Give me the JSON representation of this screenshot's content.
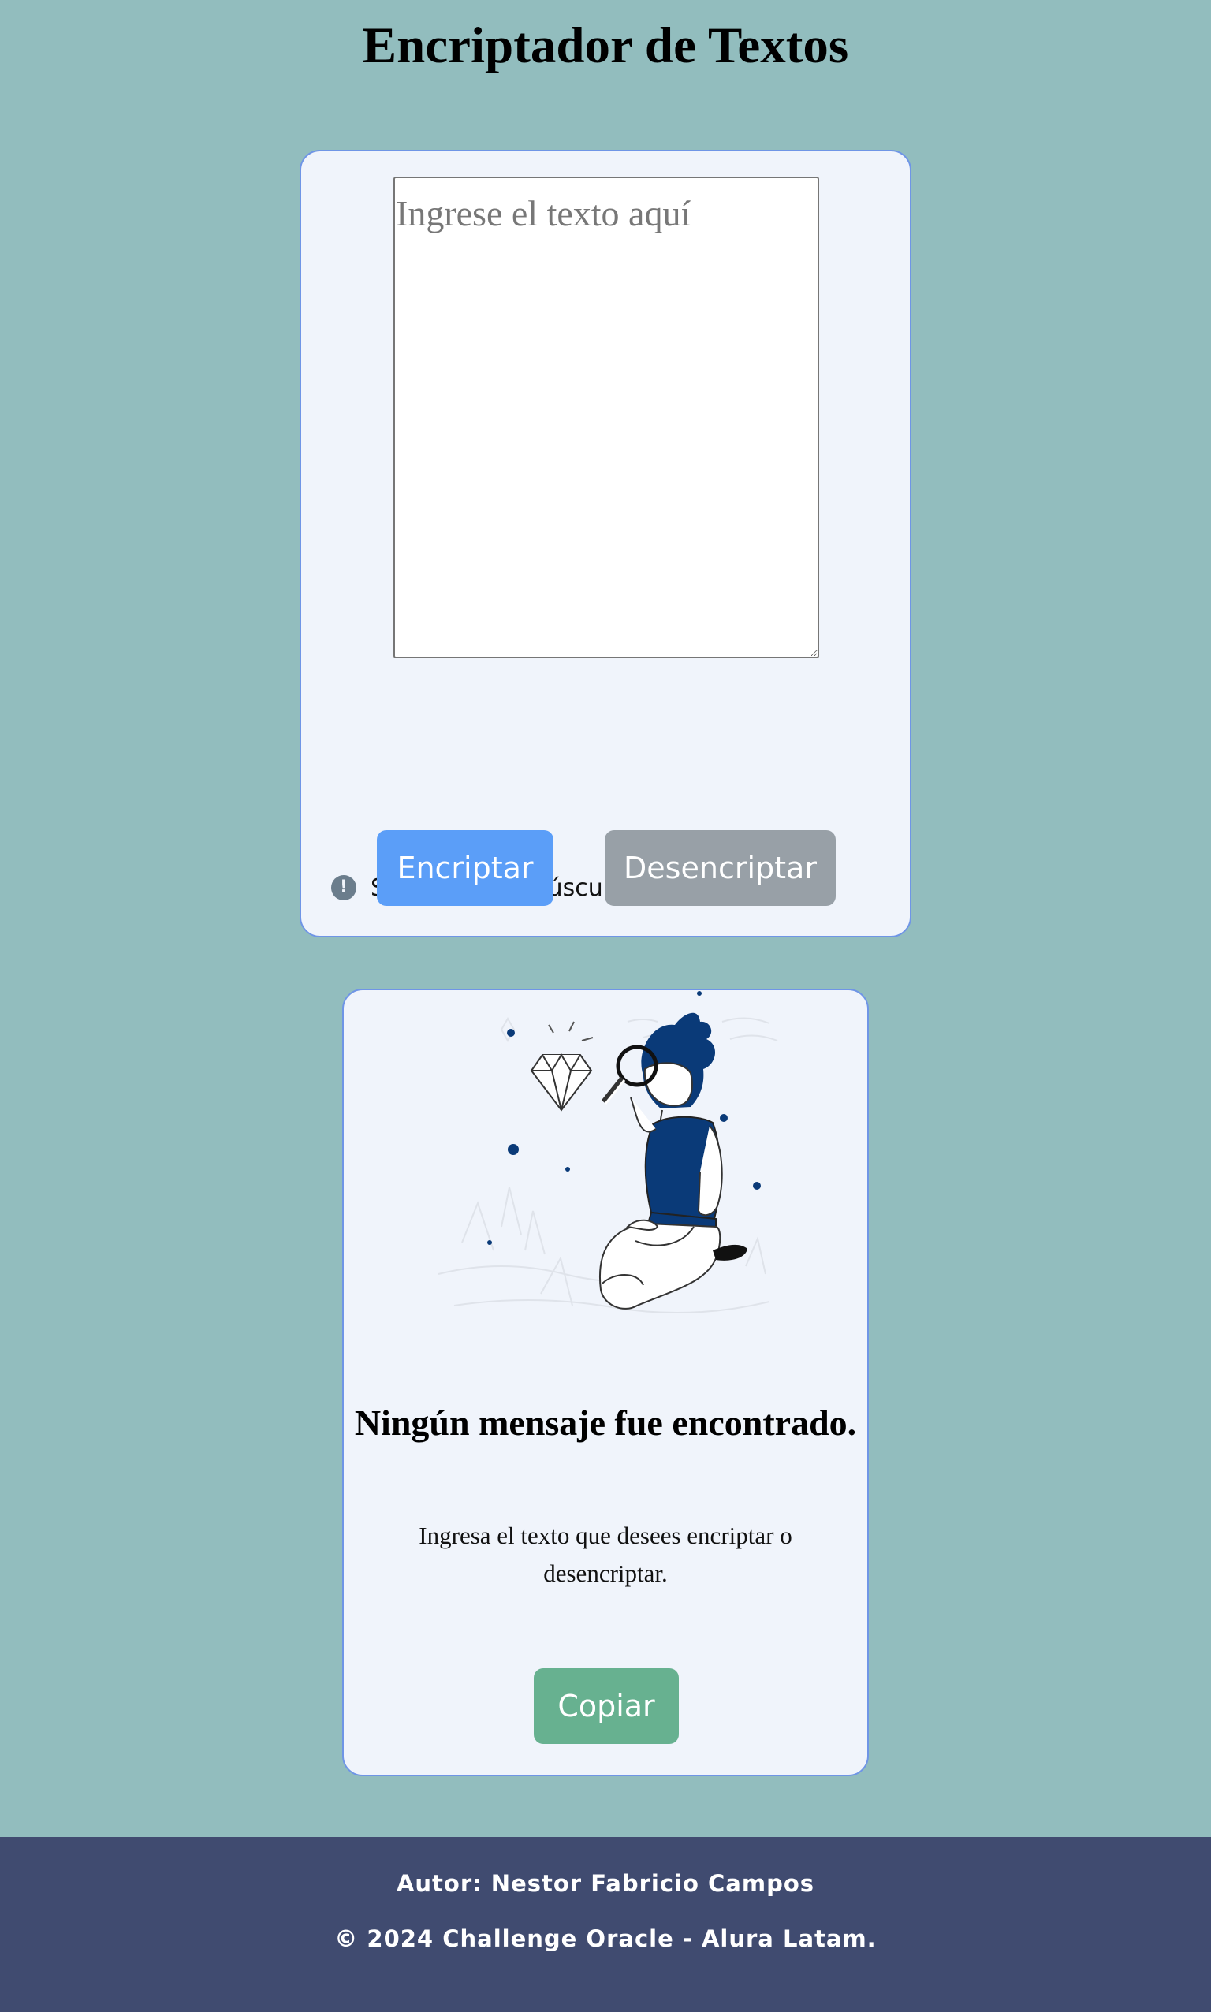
{
  "header": {
    "title": "Encriptador de Textos"
  },
  "input_card": {
    "textarea_placeholder": "Ingrese el texto aquí",
    "textarea_value": "",
    "notice_icon": "exclamation-circle-icon",
    "notice_text": "Solo letras minúsculas, sin acento.",
    "encrypt_label": "Encriptar",
    "decrypt_label": "Desencriptar"
  },
  "output_card": {
    "illustration": "person-with-magnifying-glass-and-diamond",
    "title": "Ningún mensaje fue encontrado.",
    "description": "Ingresa el texto que desees encriptar o desencriptar.",
    "copy_label": "Copiar"
  },
  "footer": {
    "author": "Autor: Nestor Fabricio Campos",
    "copyright": "© 2024 Challenge Oracle - Alura Latam."
  },
  "colors": {
    "page_background": "#92bdbe",
    "card_background": "#f0f4fb",
    "card_border": "#6f95e6",
    "encrypt_button": "#5b9ef8",
    "decrypt_button": "#98a0a7",
    "copy_button": "#67b190",
    "footer_background": "#404b70",
    "illustration_accent": "#0a3a78"
  }
}
